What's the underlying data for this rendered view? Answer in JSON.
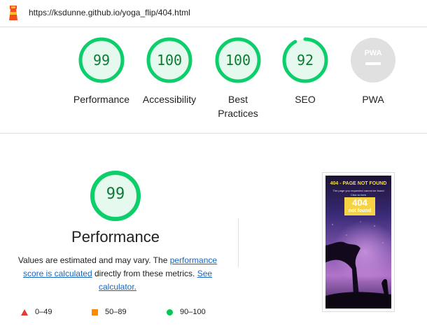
{
  "header": {
    "url": "https://ksdunne.github.io/yoga_flip/404.html"
  },
  "categories": [
    {
      "score": "99",
      "label": "Performance",
      "progress": 0.99,
      "color": "#0cce6b"
    },
    {
      "score": "100",
      "label": "Accessibility",
      "progress": 1.0,
      "color": "#0cce6b"
    },
    {
      "score": "100",
      "label": "Best Practices",
      "progress": 1.0,
      "color": "#0cce6b"
    },
    {
      "score": "92",
      "label": "SEO",
      "progress": 0.92,
      "color": "#0cce6b"
    },
    {
      "score": "",
      "label": "PWA",
      "badge": "PWA",
      "color": "#cccccc"
    }
  ],
  "performance": {
    "score": "99",
    "progress": 0.99,
    "title": "Performance",
    "desc_prefix": "Values are estimated and may vary. The ",
    "link1": "performance score is calculated",
    "desc_middle": " directly from these metrics. ",
    "link2": "See calculator."
  },
  "legend": [
    {
      "icon": "fail-triangle-icon",
      "range": "0–49",
      "color": "#e53935"
    },
    {
      "icon": "average-square-icon",
      "range": "50–89",
      "color": "#fb8c00"
    },
    {
      "icon": "pass-circle-icon",
      "range": "90–100",
      "color": "#00c853"
    }
  ],
  "screenshot": {
    "title": "404 - PAGE NOT FOUND",
    "line1": "The page you requested cannot be found",
    "line2": "Click to here",
    "big": "404",
    "small": "not found"
  }
}
